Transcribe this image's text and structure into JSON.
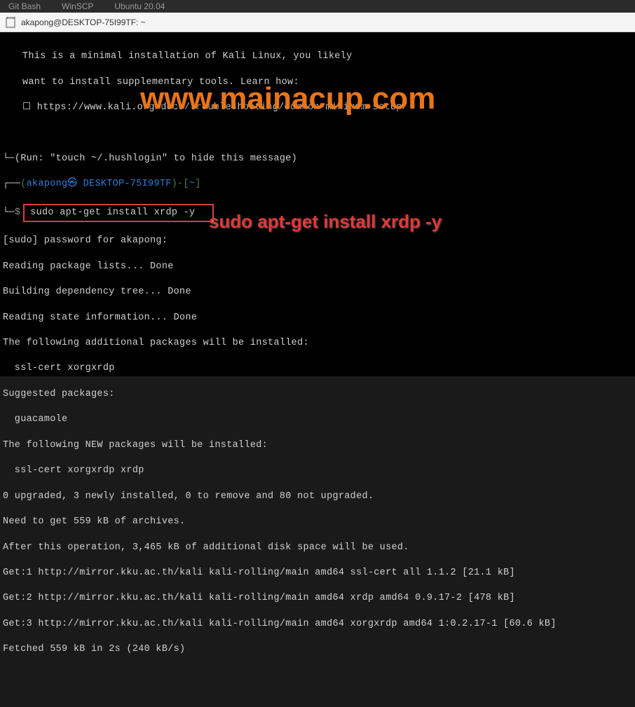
{
  "taskbar": {
    "items": [
      "Git Bash",
      "WinSCP",
      "Ubuntu 20.04"
    ]
  },
  "titlebar": {
    "title": "akapong@DESKTOP-75I99TF: ~"
  },
  "terminal": {
    "motd1": "This is a minimal installation of Kali Linux, you likely",
    "motd2": "want to install supplementary tools. Learn how:",
    "motd3": "☐ https://www.kali.org/docs/troubleshooting/common-minimum-setup/",
    "hushlogin": "(Run: \"touch ~/.hushlogin\" to hide this message)",
    "prompt_user": "akapong㉿ DESKTOP-75I99TF",
    "prompt_path": "~",
    "command": "sudo apt-get install xrdp -y",
    "sudo_prompt": "[sudo] password for akapong:",
    "line1": "Reading package lists... Done",
    "line2": "Building dependency tree... Done",
    "line3": "Reading state information... Done",
    "line4": "The following additional packages will be installed:",
    "line5": "  ssl-cert xorgxrdp",
    "line6": "Suggested packages:",
    "line7": "  guacamole",
    "line8": "The following NEW packages will be installed:",
    "line9": "  ssl-cert xorgxrdp xrdp",
    "line10": "0 upgraded, 3 newly installed, 0 to remove and 80 not upgraded.",
    "line11": "Need to get 559 kB of archives.",
    "line12": "After this operation, 3,465 kB of additional disk space will be used.",
    "line13": "Get:1 http://mirror.kku.ac.th/kali kali-rolling/main amd64 ssl-cert all 1.1.2 [21.1 kB]",
    "line14": "Get:2 http://mirror.kku.ac.th/kali kali-rolling/main amd64 xrdp amd64 0.9.17-2 [478 kB]",
    "line15": "Get:3 http://mirror.kku.ac.th/kali kali-rolling/main amd64 xorgxrdp amd64 1:0.2.17-1 [60.6 kB]",
    "line16": "Fetched 559 kB in 2s (240 kB/s)"
  },
  "annotations": {
    "watermark": "www.mainacup.com",
    "command_label": "sudo apt-get install xrdp -y"
  }
}
